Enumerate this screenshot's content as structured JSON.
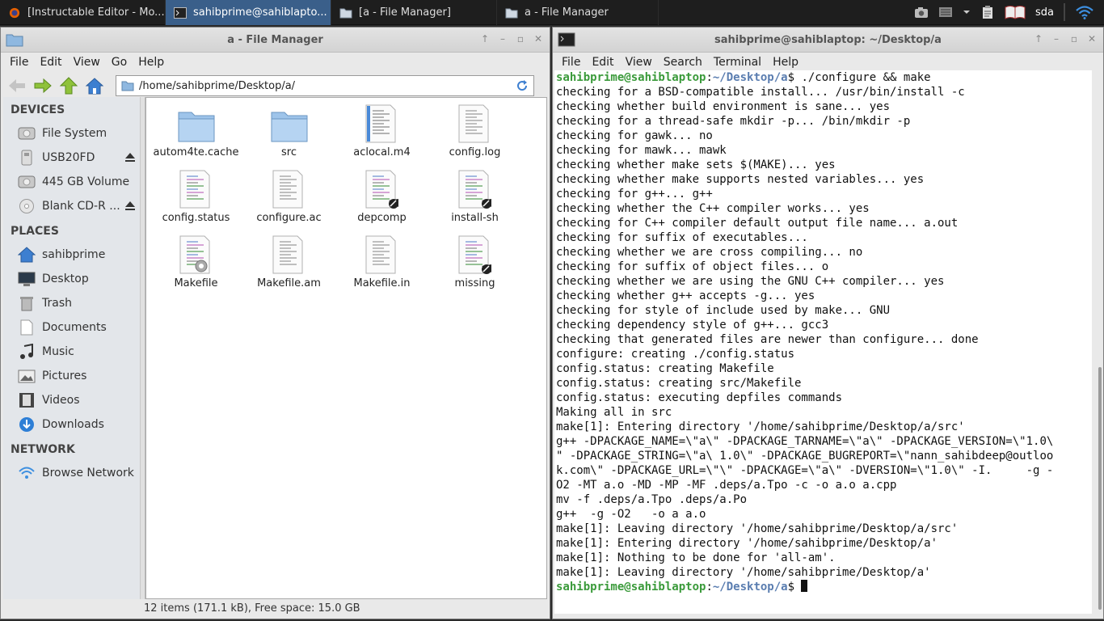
{
  "taskbar": {
    "tasks": [
      {
        "label": "[Instructable Editor - Mo...",
        "icon": "firefox-icon",
        "active": false
      },
      {
        "label": "sahibprime@sahiblapto...",
        "icon": "terminal-icon",
        "active": true
      },
      {
        "label": "[a - File Manager]",
        "icon": "folder-icon",
        "active": false
      },
      {
        "label": "a - File Manager",
        "icon": "folder-icon",
        "active": false
      }
    ],
    "tray": {
      "device_label": "sda"
    }
  },
  "file_manager": {
    "title": "a - File Manager",
    "menu": [
      "File",
      "Edit",
      "View",
      "Go",
      "Help"
    ],
    "location": "/home/sahibprime/Desktop/a/",
    "sidebar": {
      "devices_heading": "DEVICES",
      "devices": [
        {
          "label": "File System",
          "icon": "harddisk-icon",
          "eject": false
        },
        {
          "label": "USB20FD",
          "icon": "usb-drive-icon",
          "eject": true
        },
        {
          "label": "445 GB Volume",
          "icon": "harddisk-icon",
          "eject": false
        },
        {
          "label": "Blank CD-R ...",
          "icon": "optical-disc-icon",
          "eject": true
        }
      ],
      "places_heading": "PLACES",
      "places": [
        {
          "label": "sahibprime",
          "icon": "home-icon"
        },
        {
          "label": "Desktop",
          "icon": "desktop-icon"
        },
        {
          "label": "Trash",
          "icon": "trash-icon"
        },
        {
          "label": "Documents",
          "icon": "document-icon"
        },
        {
          "label": "Music",
          "icon": "music-icon"
        },
        {
          "label": "Pictures",
          "icon": "pictures-icon"
        },
        {
          "label": "Videos",
          "icon": "videos-icon"
        },
        {
          "label": "Downloads",
          "icon": "downloads-icon"
        }
      ],
      "network_heading": "NETWORK",
      "network": [
        {
          "label": "Browse Network",
          "icon": "network-icon"
        }
      ]
    },
    "files": [
      {
        "name": "autom4te.cache",
        "type": "folder"
      },
      {
        "name": "src",
        "type": "folder"
      },
      {
        "name": "aclocal.m4",
        "type": "text-blue"
      },
      {
        "name": "config.log",
        "type": "text"
      },
      {
        "name": "config.status",
        "type": "script"
      },
      {
        "name": "configure.ac",
        "type": "text"
      },
      {
        "name": "depcomp",
        "type": "script-link"
      },
      {
        "name": "install-sh",
        "type": "script-link"
      },
      {
        "name": "Makefile",
        "type": "makefile"
      },
      {
        "name": "Makefile.am",
        "type": "text"
      },
      {
        "name": "Makefile.in",
        "type": "text"
      },
      {
        "name": "missing",
        "type": "script-link"
      }
    ],
    "status": "12 items (171.1 kB), Free space: 15.0 GB"
  },
  "terminal": {
    "title": "sahibprime@sahiblaptop: ~/Desktop/a",
    "menu": [
      "File",
      "Edit",
      "View",
      "Search",
      "Terminal",
      "Help"
    ],
    "prompt_user": "sahibprime@sahiblaptop",
    "prompt_sep": ":",
    "prompt_path": "~/Desktop/a",
    "prompt_end": "$ ",
    "command": "./configure && make",
    "output": [
      "checking for a BSD-compatible install... /usr/bin/install -c",
      "checking whether build environment is sane... yes",
      "checking for a thread-safe mkdir -p... /bin/mkdir -p",
      "checking for gawk... no",
      "checking for mawk... mawk",
      "checking whether make sets $(MAKE)... yes",
      "checking whether make supports nested variables... yes",
      "checking for g++... g++",
      "checking whether the C++ compiler works... yes",
      "checking for C++ compiler default output file name... a.out",
      "checking for suffix of executables...",
      "checking whether we are cross compiling... no",
      "checking for suffix of object files... o",
      "checking whether we are using the GNU C++ compiler... yes",
      "checking whether g++ accepts -g... yes",
      "checking for style of include used by make... GNU",
      "checking dependency style of g++... gcc3",
      "checking that generated files are newer than configure... done",
      "configure: creating ./config.status",
      "config.status: creating Makefile",
      "config.status: creating src/Makefile",
      "config.status: executing depfiles commands",
      "Making all in src",
      "make[1]: Entering directory '/home/sahibprime/Desktop/a/src'",
      "g++ -DPACKAGE_NAME=\\\"a\\\" -DPACKAGE_TARNAME=\\\"a\\\" -DPACKAGE_VERSION=\\\"1.0\\",
      "\" -DPACKAGE_STRING=\\\"a\\ 1.0\\\" -DPACKAGE_BUGREPORT=\\\"nann_sahibdeep@outloo",
      "k.com\\\" -DPACKAGE_URL=\\\"\\\" -DPACKAGE=\\\"a\\\" -DVERSION=\\\"1.0\\\" -I.     -g -",
      "O2 -MT a.o -MD -MP -MF .deps/a.Tpo -c -o a.o a.cpp",
      "mv -f .deps/a.Tpo .deps/a.Po",
      "g++  -g -O2   -o a a.o",
      "make[1]: Leaving directory '/home/sahibprime/Desktop/a/src'",
      "make[1]: Entering directory '/home/sahibprime/Desktop/a'",
      "make[1]: Nothing to be done for 'all-am'.",
      "make[1]: Leaving directory '/home/sahibprime/Desktop/a'"
    ]
  }
}
